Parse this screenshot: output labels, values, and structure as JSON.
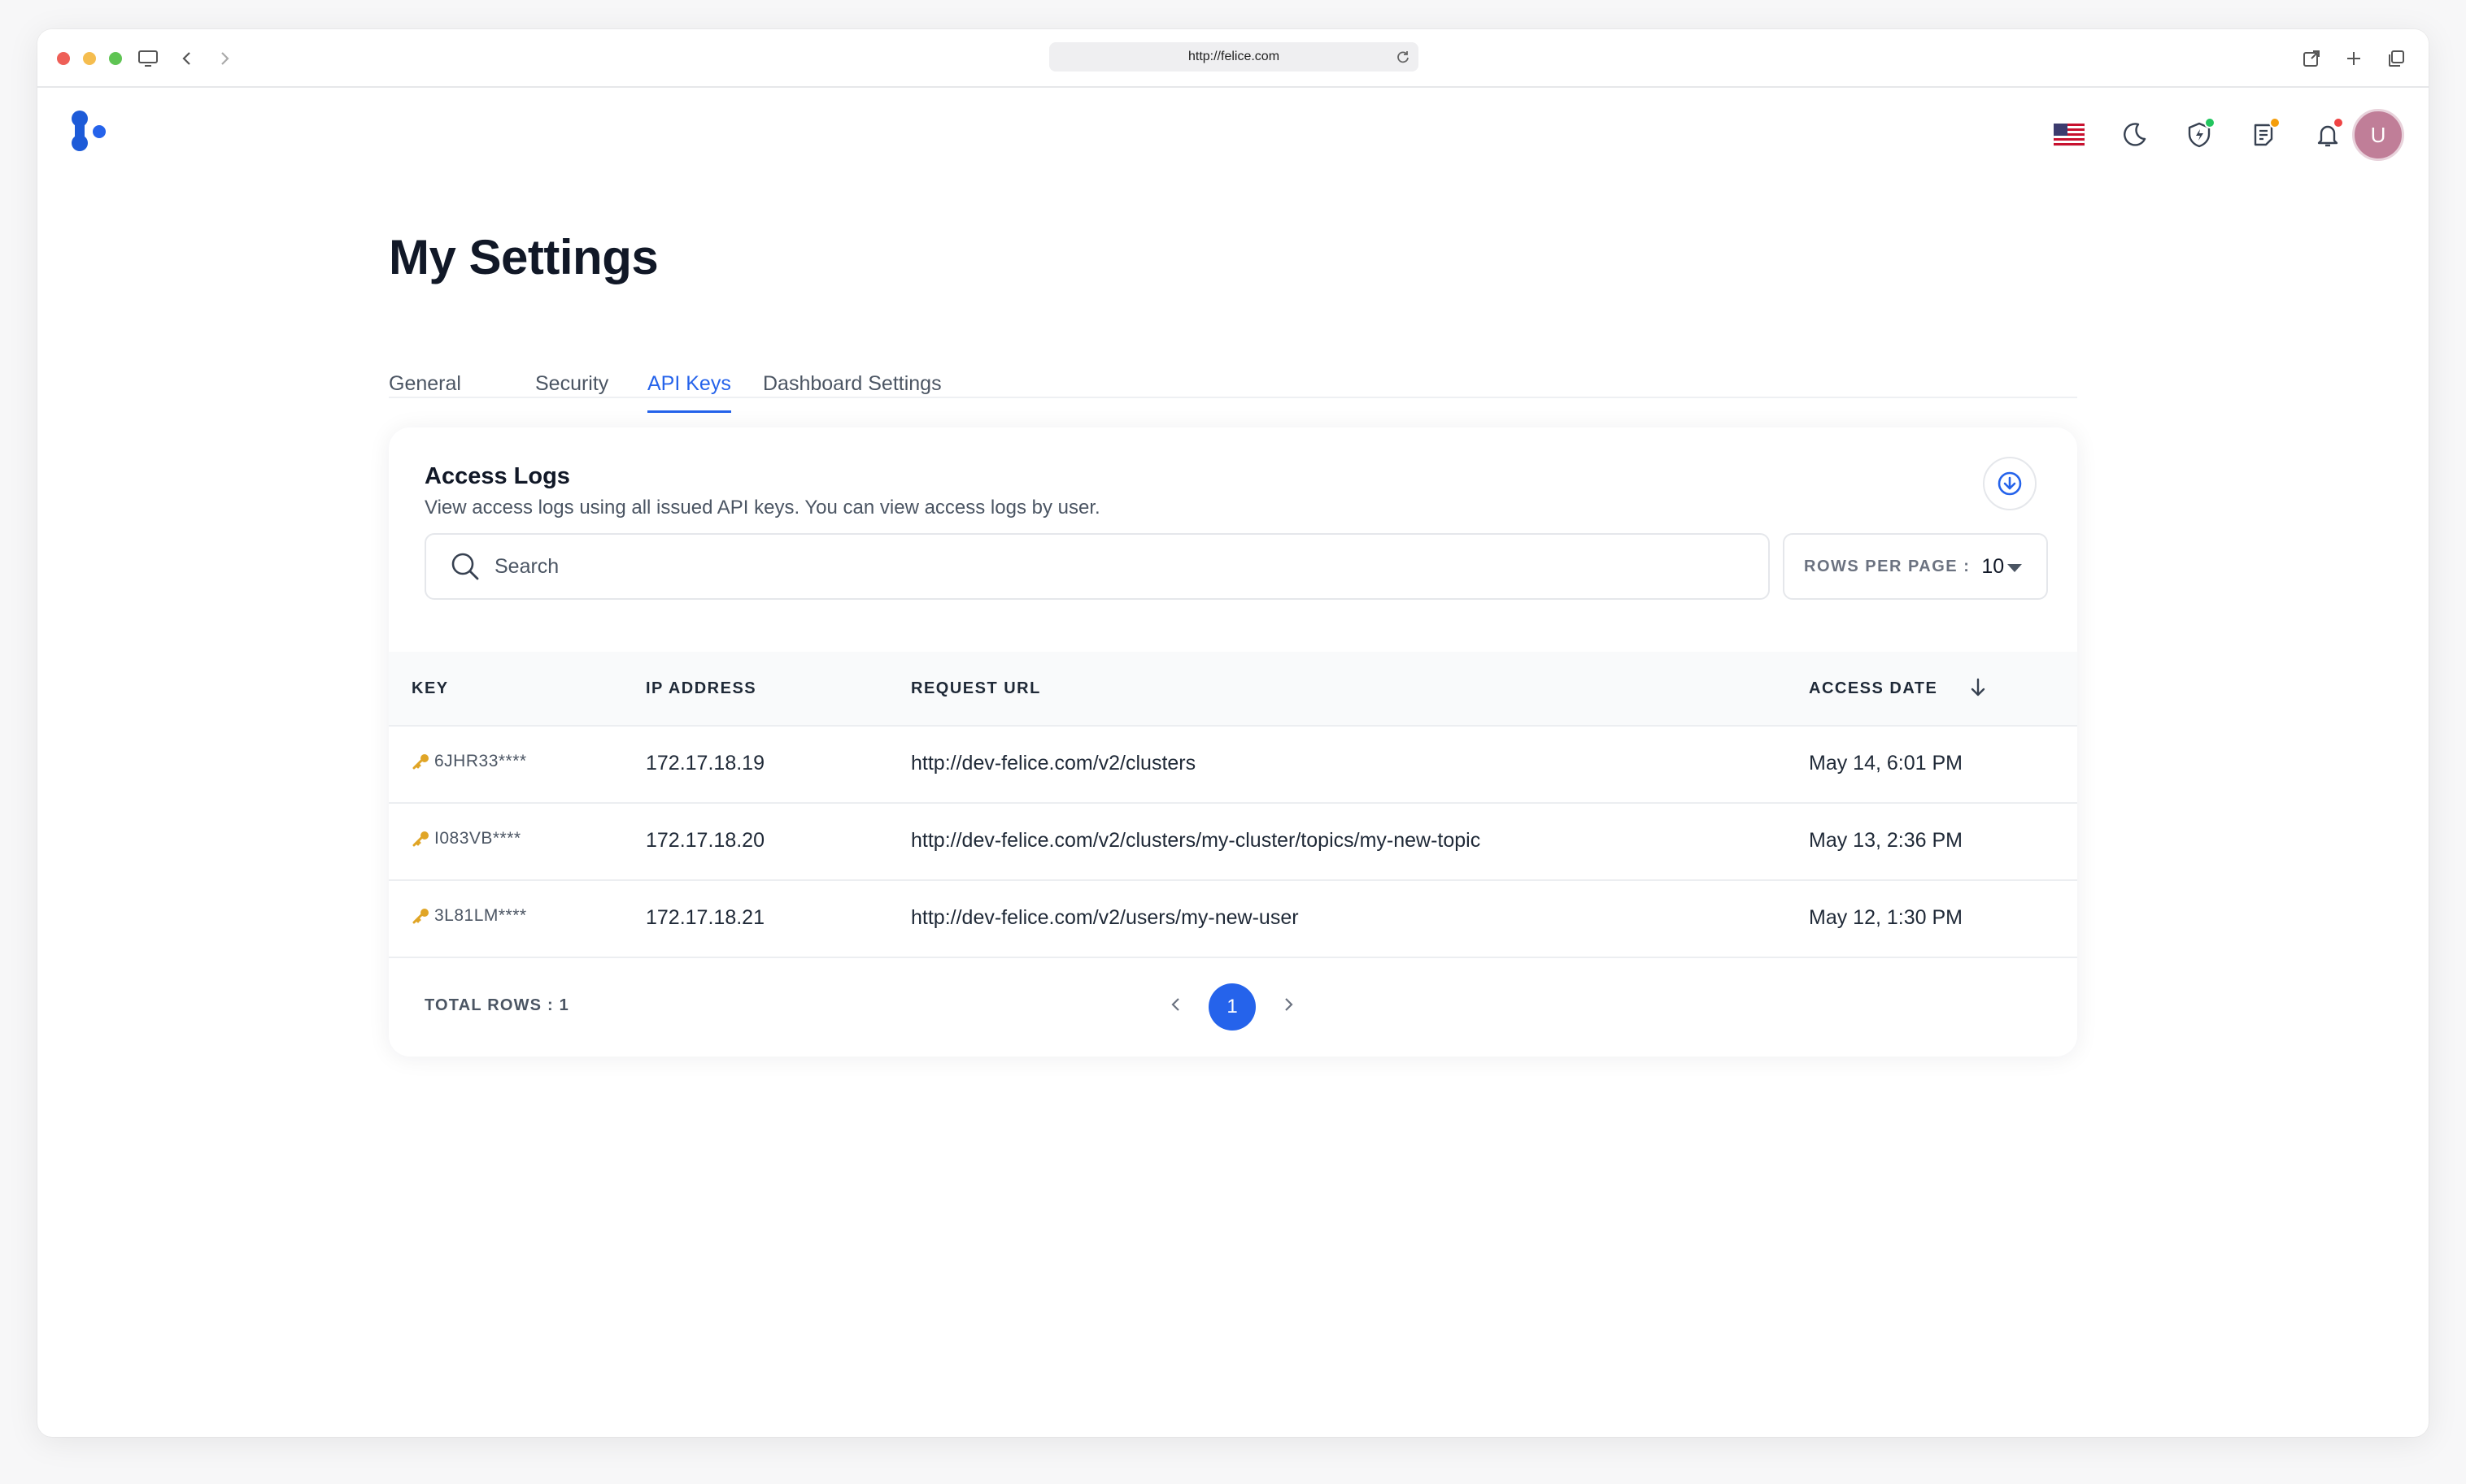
{
  "browser": {
    "url": "http://felice.com"
  },
  "header": {
    "avatar_initial": "U",
    "flag": "us-flag-icon",
    "status_dots": {
      "shield": "#22c55e",
      "notes": "#f59e0b",
      "bell": "#ef4444"
    }
  },
  "page": {
    "title": "My Settings",
    "tabs": [
      {
        "label": "General",
        "active": false
      },
      {
        "label": "Security",
        "active": false
      },
      {
        "label": "API Keys",
        "active": true
      },
      {
        "label": "Dashboard Settings",
        "active": false
      }
    ]
  },
  "access_logs": {
    "title": "Access Logs",
    "subtitle": "View access logs using all issued API keys. You can view access logs by user.",
    "search_placeholder": "Search",
    "rows_per_page_label": "ROWS PER PAGE :",
    "rows_per_page_value": "10",
    "columns": [
      "KEY",
      "IP ADDRESS",
      "REQUEST URL",
      "ACCESS DATE"
    ],
    "rows": [
      {
        "key": "6JHR33****",
        "ip": "172.17.18.19",
        "url": "http://dev-felice.com/v2/clusters",
        "date": "May 14, 6:01 PM"
      },
      {
        "key": "I083VB****",
        "ip": "172.17.18.20",
        "url": "http://dev-felice.com/v2/clusters/my-cluster/topics/my-new-topic",
        "date": "May 13, 2:36 PM"
      },
      {
        "key": "3L81LM****",
        "ip": "172.17.18.21",
        "url": "http://dev-felice.com/v2/users/my-new-user",
        "date": "May 12, 1:30 PM"
      }
    ],
    "total_rows_label": "TOTAL ROWS : 1",
    "current_page": "1"
  },
  "colors": {
    "accent": "#2563eb",
    "text_primary": "#111827",
    "text_secondary": "#4b5563",
    "key_icon": "#e0a526"
  }
}
